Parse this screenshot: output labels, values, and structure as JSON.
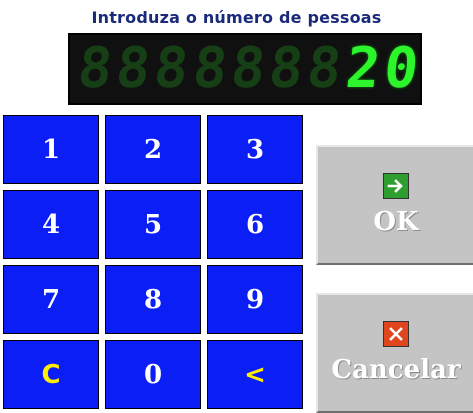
{
  "prompt": "Introduza o número de pessoas",
  "display": {
    "value": "20",
    "digits": [
      "8",
      "8",
      "8",
      "8",
      "8",
      "8",
      "8",
      "2",
      "0"
    ],
    "lit": [
      false,
      false,
      false,
      false,
      false,
      false,
      false,
      true,
      true
    ],
    "lit_color": "#2cf52c",
    "unlit_color": "#163f16"
  },
  "keypad": {
    "keys": [
      {
        "label": "1",
        "name": "key-1"
      },
      {
        "label": "2",
        "name": "key-2"
      },
      {
        "label": "3",
        "name": "key-3"
      },
      {
        "label": "4",
        "name": "key-4"
      },
      {
        "label": "5",
        "name": "key-5"
      },
      {
        "label": "6",
        "name": "key-6"
      },
      {
        "label": "7",
        "name": "key-7"
      },
      {
        "label": "8",
        "name": "key-8"
      },
      {
        "label": "9",
        "name": "key-9"
      },
      {
        "label": "C",
        "name": "clear-key"
      },
      {
        "label": "0",
        "name": "key-0"
      },
      {
        "label": "<",
        "name": "backspace-key"
      }
    ],
    "key_color": "#0a1ef5",
    "accent_label_color": "#ffee00"
  },
  "buttons": {
    "ok": {
      "label": "OK",
      "icon": "arrow-right-icon",
      "icon_color": "#2e9e2e"
    },
    "cancel": {
      "label": "Cancelar",
      "icon": "close-icon",
      "icon_color": "#e0461e"
    }
  }
}
